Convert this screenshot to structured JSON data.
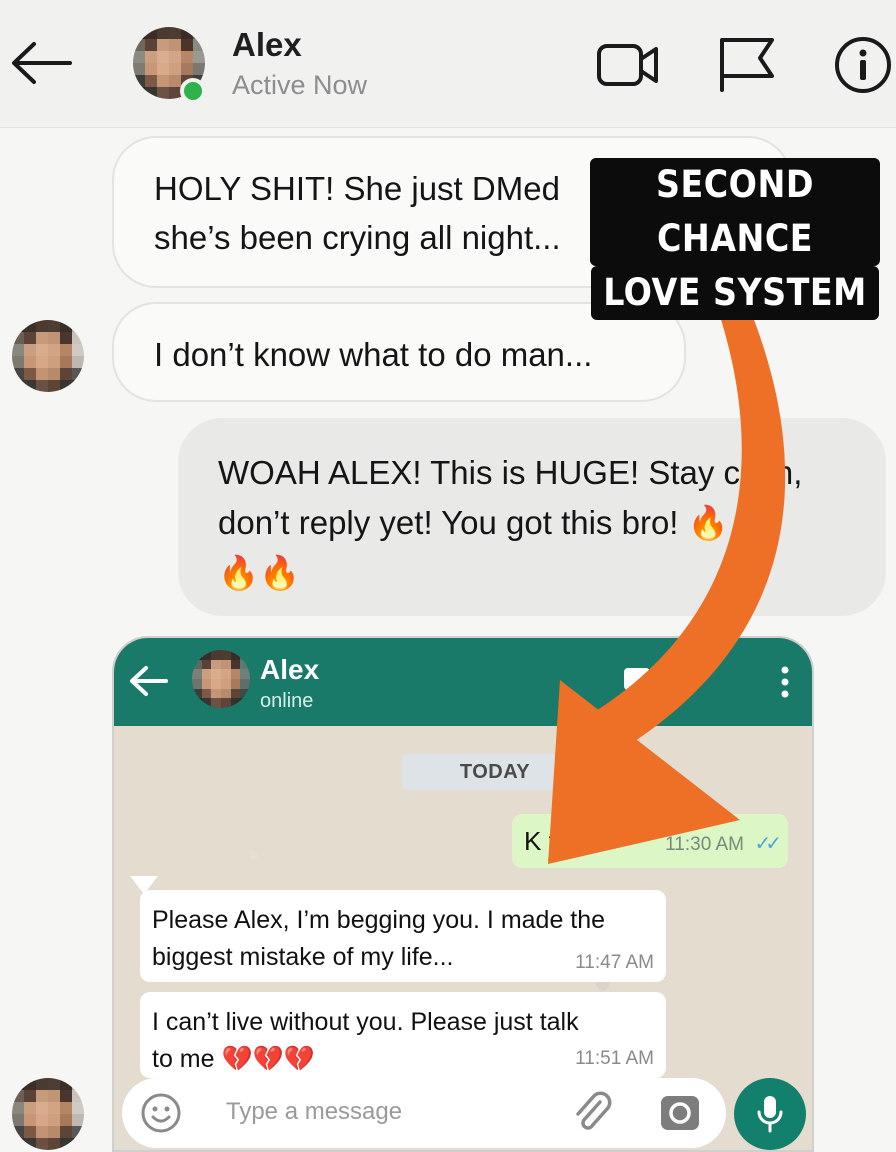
{
  "header": {
    "contact_name": "Alex",
    "status": "Active Now",
    "icons": [
      "back-arrow-icon",
      "video-camera-icon",
      "flag-icon",
      "info-icon"
    ]
  },
  "messages": [
    {
      "side": "left",
      "lines": [
        "HOLY SHIT! She just DMed",
        "she’s been crying all night..."
      ]
    },
    {
      "side": "left",
      "lines": [
        "I don’t know what to do man..."
      ]
    },
    {
      "side": "right",
      "lines": [
        "WOAH ALEX! This is HUGE! Stay calm,",
        "don’t reply yet! You got this bro!",
        "🔥🔥"
      ],
      "trail_emoji": "🔥"
    }
  ],
  "whatsapp": {
    "contact_name": "Alex",
    "status": "online",
    "date_divider": "TODAY",
    "outgoing": {
      "text": "K th...",
      "time": "11:30 AM",
      "ticks": "✓✓"
    },
    "incoming": [
      {
        "lines": [
          "Please Alex, I’m begging you. I made the",
          "biggest mistake of my life..."
        ],
        "time": "11:47 AM"
      },
      {
        "lines": [
          "I can’t live without you. Please just talk",
          "to me 💔💔💔"
        ],
        "time": "11:51 AM"
      }
    ],
    "input_placeholder": "Type a message",
    "colors": {
      "header": "#1a7a69",
      "outgoing_bubble": "#dcf7c5",
      "mic_button": "#12806c"
    }
  },
  "overlay": {
    "label_lines": [
      "SECOND CHANCE",
      "LOVE SYSTEM"
    ],
    "arrow_color": "#ee7027"
  }
}
